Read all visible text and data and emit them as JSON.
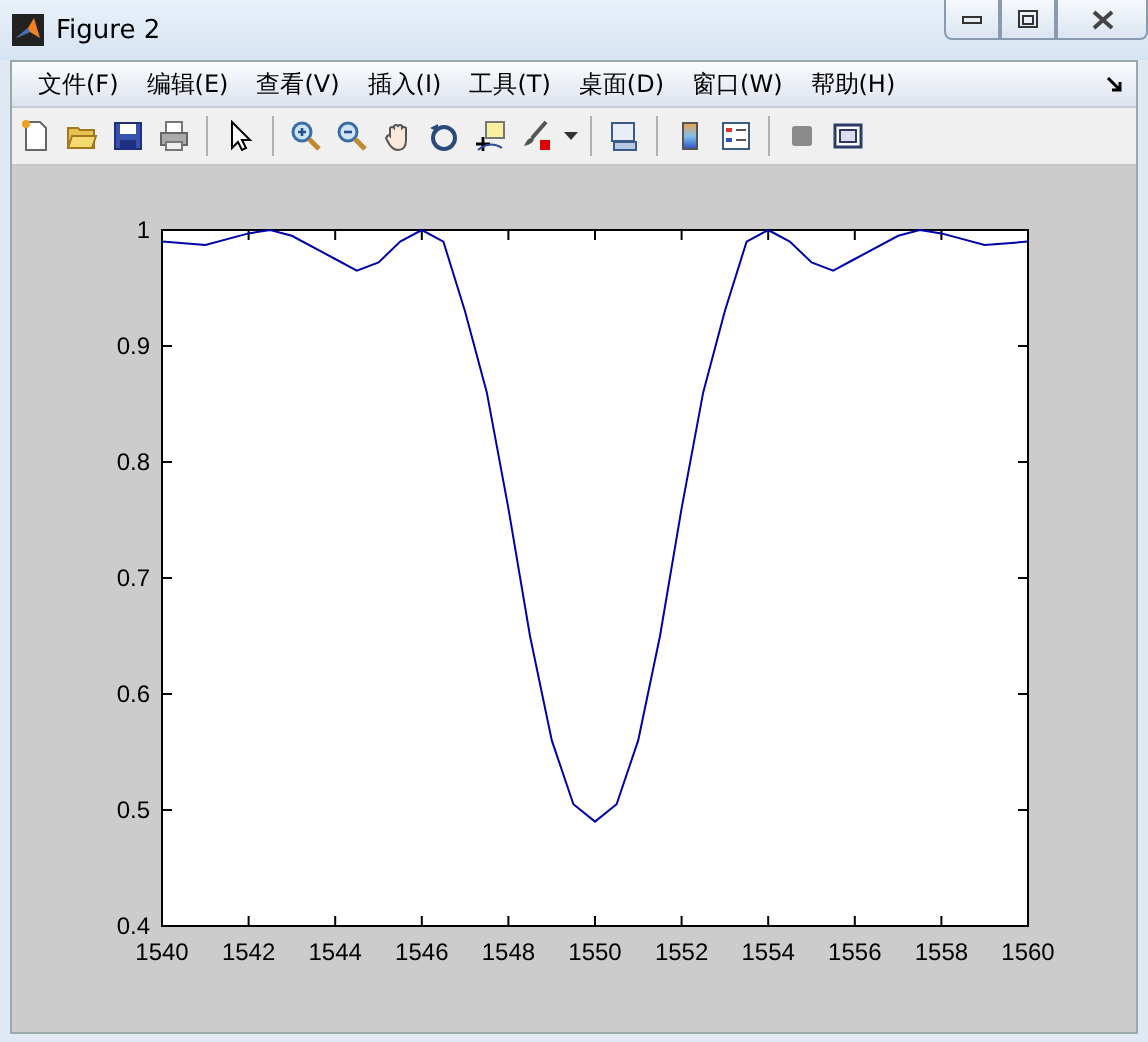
{
  "window": {
    "title": "Figure 2"
  },
  "menu": [
    "文件(F)",
    "编辑(E)",
    "查看(V)",
    "插入(I)",
    "工具(T)",
    "桌面(D)",
    "窗口(W)",
    "帮助(H)"
  ],
  "plot": {
    "chart_data": {
      "type": "line",
      "x": [
        1540,
        1541,
        1542,
        1542.5,
        1543,
        1544,
        1544.5,
        1545,
        1545.5,
        1546,
        1546.5,
        1547,
        1547.5,
        1548,
        1548.5,
        1549,
        1549.5,
        1550,
        1550.5,
        1551,
        1551.5,
        1552,
        1552.5,
        1553,
        1553.5,
        1554,
        1554.5,
        1555,
        1555.5,
        1556,
        1557,
        1557.5,
        1558,
        1559,
        1560
      ],
      "series": [
        {
          "color": "#0000aa",
          "values": [
            0.99,
            0.987,
            0.997,
            1.0,
            0.995,
            0.975,
            0.965,
            0.972,
            0.99,
            1.0,
            0.99,
            0.93,
            0.86,
            0.76,
            0.65,
            0.56,
            0.505,
            0.49,
            0.505,
            0.56,
            0.65,
            0.76,
            0.86,
            0.93,
            0.99,
            1.0,
            0.99,
            0.972,
            0.965,
            0.975,
            0.995,
            1.0,
            0.997,
            0.987,
            0.99
          ]
        }
      ],
      "xlim": [
        1540,
        1560
      ],
      "ylim": [
        0.4,
        1
      ],
      "xticks": [
        1540,
        1542,
        1544,
        1546,
        1548,
        1550,
        1552,
        1554,
        1556,
        1558,
        1560
      ],
      "yticks": [
        {
          "value": 0.4,
          "label": "0.4"
        },
        {
          "value": 0.5,
          "label": "0.5"
        },
        {
          "value": 0.6,
          "label": "0.6"
        },
        {
          "value": 0.7,
          "label": "0.7"
        },
        {
          "value": 0.8,
          "label": "0.8"
        },
        {
          "value": 0.9,
          "label": "0.9"
        },
        {
          "value": 1,
          "label": "1"
        }
      ]
    }
  }
}
